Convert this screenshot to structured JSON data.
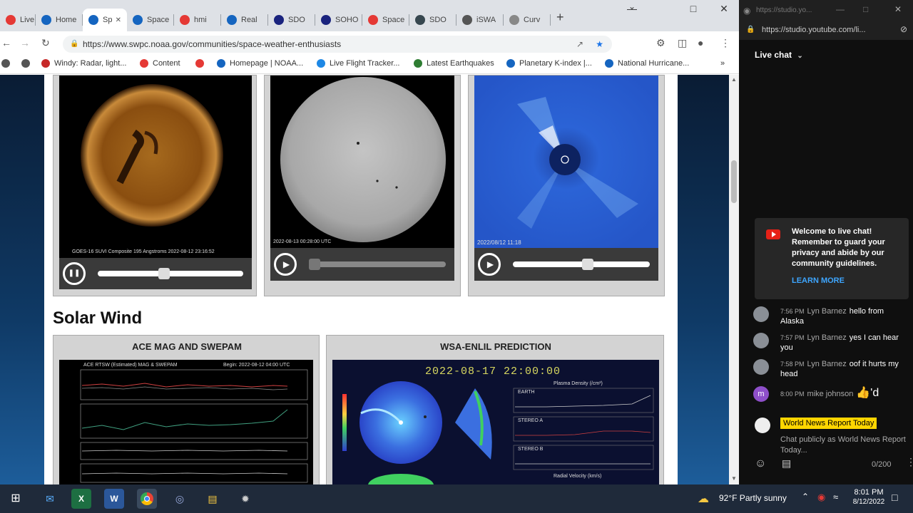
{
  "browser": {
    "tabs": [
      {
        "title": "Live",
        "color": "#e53935"
      },
      {
        "title": "Home",
        "color": "#1565c0"
      },
      {
        "title": "Sp",
        "color": "#1565c0",
        "active": true
      },
      {
        "title": "Space",
        "color": "#1565c0"
      },
      {
        "title": "hmi",
        "color": "#e53935"
      },
      {
        "title": "Real",
        "color": "#1565c0"
      },
      {
        "title": "SDO",
        "color": "#1a237e"
      },
      {
        "title": "SOHO",
        "color": "#1a237e"
      },
      {
        "title": "Space",
        "color": "#e53935"
      },
      {
        "title": "SDO",
        "color": "#37474f"
      },
      {
        "title": "iSWA",
        "color": "#555555"
      },
      {
        "title": "Curv",
        "color": "#888888"
      }
    ],
    "new_tab": "+",
    "minimize": "⌄",
    "restore": "—",
    "maximize": "□",
    "close": "✕",
    "url": "https://www.swpc.noaa.gov/communities/space-weather-enthusiasts",
    "bookmarks": [
      {
        "label": "Windy: Radar, light...",
        "color": "#c62828"
      },
      {
        "label": "Content",
        "color": "#e53935"
      },
      {
        "label": "",
        "color": "#e53935"
      },
      {
        "label": "Homepage | NOAA...",
        "color": "#1565c0"
      },
      {
        "label": "Live Flight Tracker...",
        "color": "#1e88e5"
      },
      {
        "label": "Latest Earthquakes",
        "color": "#2e7d32"
      },
      {
        "label": "Planetary K-index |...",
        "color": "#1565c0"
      },
      {
        "label": "National Hurricane...",
        "color": "#1565c0"
      }
    ],
    "bookmarks_more": "»"
  },
  "page": {
    "panels": [
      {
        "caption": "GOES-16 SUVI Composite 195 Angstroms 2022-08-12 23:16:52",
        "playing": true,
        "slider": 0.45
      },
      {
        "caption": "2022-08-13 00:28:00 UTC",
        "playing": false,
        "slider": 0.0
      },
      {
        "caption": "2022/08/12 11:18",
        "playing": false,
        "slider": 0.55
      }
    ],
    "pause_icon": "❚❚",
    "play_icon": "▶",
    "section_title": "Solar Wind",
    "ace_title": "ACE MAG AND SWEPAM",
    "ace_header_left": "ACE RTSW (Estimated) MAG & SWEPAM",
    "ace_header_right": "Begin: 2022-08-12 04:00 UTC",
    "enlil_title": "WSA-ENLIL PREDICTION",
    "enlil_date": "2022-08-17 22:00:00",
    "enlil_labels": [
      "EARTH",
      "STEREO A",
      "STEREO B"
    ],
    "enlil_density": "Plasma Density (/cm³)",
    "enlil_velocity": "Radial Velocity (km/s)"
  },
  "chat": {
    "url": "https://studio.yo...",
    "address": "https://studio.youtube.com/li...",
    "header": "Live chat",
    "welcome": "Welcome to live chat! Remember to guard your privacy and abide by our community guidelines.",
    "learn_more": "LEARN MORE",
    "messages": [
      {
        "time": "7:56 PM",
        "author": "Lyn Barnez",
        "text": "hello from Alaska"
      },
      {
        "time": "7:57 PM",
        "author": "Lyn Barnez",
        "text": "yes I can hear you"
      },
      {
        "time": "7:58 PM",
        "author": "Lyn Barnez",
        "text": "oof it hurts my head"
      },
      {
        "time": "8:00 PM",
        "author": "mike johnson",
        "text": "👍'd"
      }
    ],
    "mike_initial": "m",
    "channel_name": "World News Report Today",
    "input_placeholder": "Chat publicly as World News Report Today...",
    "counter": "0/200"
  },
  "taskbar": {
    "weather": "92°F  Partly sunny",
    "time": "8:01 PM",
    "date": "8/12/2022"
  }
}
